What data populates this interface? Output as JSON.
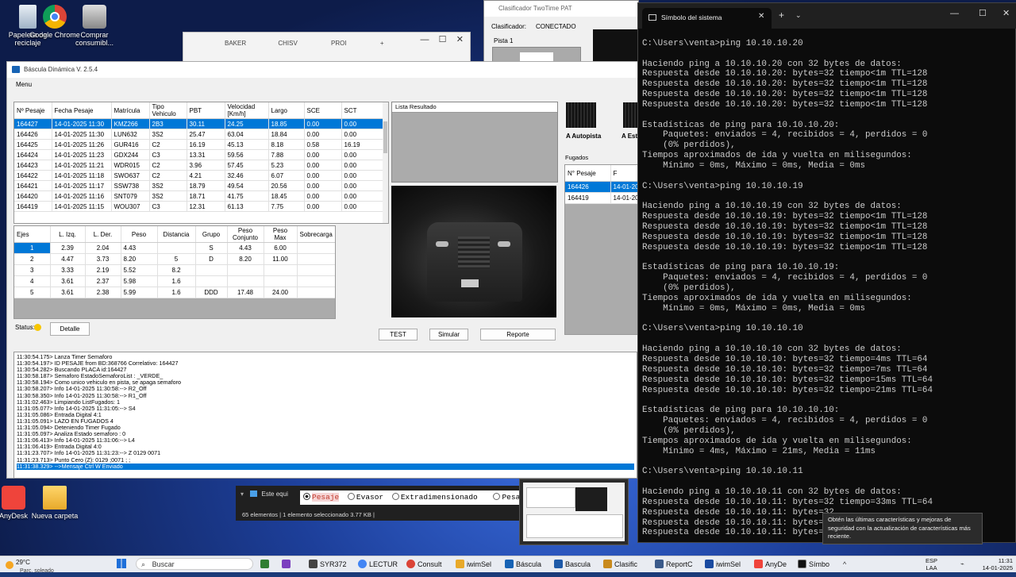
{
  "desktop": {
    "icons": [
      {
        "label": "Papelera de reciclaje"
      },
      {
        "label": "Google Chrome"
      },
      {
        "label": "Comprar consumibl..."
      },
      {
        "label": "AnyDesk"
      },
      {
        "label": "Nueva carpeta"
      }
    ]
  },
  "clasificador": {
    "title": "Clasificador TwoTime PAT",
    "status_label": "Clasificador:",
    "status_value": "CONECTADO",
    "pista": "Pista 1"
  },
  "explorer": {
    "tabs": [
      "BAKER",
      "CHISV",
      "PROI"
    ]
  },
  "app": {
    "title": "Báscula Dinámica V. 2.5.4",
    "menu": "Menu",
    "weighings": {
      "headers": [
        "Nº Pesaje",
        "Fecha Pesaje",
        "Matrícula",
        "Tipo Vehiculo",
        "PBT",
        "Velocidad [Km/h]",
        "Largo",
        "SCE",
        "SCT"
      ],
      "rows": [
        [
          "164427",
          "14-01-2025 11:30",
          "KMZ266",
          "2B3",
          "30.11",
          "24.25",
          "18.85",
          "0.00",
          "0.00"
        ],
        [
          "164426",
          "14-01-2025 11:30",
          "LUN632",
          "3S2",
          "25.47",
          "63.04",
          "18.84",
          "0.00",
          "0.00"
        ],
        [
          "164425",
          "14-01-2025 11:26",
          "GUR416",
          "C2",
          "16.19",
          "45.13",
          "8.18",
          "0.58",
          "16.19"
        ],
        [
          "164424",
          "14-01-2025 11:23",
          "GDX244",
          "C3",
          "13.31",
          "59.56",
          "7.88",
          "0.00",
          "0.00"
        ],
        [
          "164423",
          "14-01-2025 11:21",
          "WDR015",
          "C2",
          "3.96",
          "57.45",
          "5.23",
          "0.00",
          "0.00"
        ],
        [
          "164422",
          "14-01-2025 11:18",
          "SWO637",
          "C2",
          "4.21",
          "32.46",
          "6.07",
          "0.00",
          "0.00"
        ],
        [
          "164421",
          "14-01-2025 11:17",
          "SSW738",
          "3S2",
          "18.79",
          "49.54",
          "20.56",
          "0.00",
          "0.00"
        ],
        [
          "164420",
          "14-01-2025 11:16",
          "SNT079",
          "3S2",
          "18.71",
          "41.75",
          "18.45",
          "0.00",
          "0.00"
        ],
        [
          "164419",
          "14-01-2025 11:15",
          "WOU307",
          "C3",
          "12.31",
          "61.13",
          "7.75",
          "0.00",
          "0.00"
        ]
      ]
    },
    "axles": {
      "headers": [
        "Ejes",
        "L. Izq.",
        "L. Der.",
        "Peso",
        "Distancia",
        "Grupo",
        "Peso Conjunto",
        "Peso Max",
        "Sobrecarga"
      ],
      "rows": [
        [
          "1",
          "2.39",
          "2.04",
          "4.43",
          "",
          "S",
          "4.43",
          "6.00",
          ""
        ],
        [
          "2",
          "4.47",
          "3.73",
          "8.20",
          "5",
          "D",
          "8.20",
          "11.00",
          ""
        ],
        [
          "3",
          "3.33",
          "2.19",
          "5.52",
          "8.2",
          "",
          "",
          "",
          ""
        ],
        [
          "4",
          "3.61",
          "2.37",
          "5.98",
          "1.6",
          "",
          "",
          "",
          ""
        ],
        [
          "5",
          "3.61",
          "2.38",
          "5.99",
          "1.6",
          "DDD",
          "17.48",
          "24.00",
          ""
        ]
      ]
    },
    "result_list_label": "Lista Resultado",
    "status_label": "Status:",
    "detail_button": "Detalle",
    "test_button": "TEST",
    "simulate_button": "Simular",
    "report_button": "Reporte",
    "lane_labels": [
      "A Autopista",
      "A Est"
    ],
    "fugados": {
      "label": "Fugados",
      "headers": [
        "N° Pesaje",
        "F"
      ],
      "rows": [
        [
          "164426",
          "14-01-2025"
        ],
        [
          "164419",
          "14-01-2025"
        ]
      ]
    },
    "log": [
      "11:30:54.175> Lanza Timer Semaforo",
      "11:30:54.197> ID PESAJE from BD:368766 Correlativo: 164427",
      "11:30:54.282> Buscando PLACA id:164427",
      "11:30:58.187> Semaforo EstadoSemaforoList : _VERDE_",
      "11:30:58.194> Como unico vehiculo en pista, se apaga semaforo",
      "11:30:58.207> Info 14-01-2025 11:30:58:--> R2_Off",
      "11:30:58.350> Info 14-01-2025 11:30:58:--> R1_Off",
      "11:31:02.463> Limpiando ListFugados: 1",
      "11:31:05.077> Info 14-01-2025 11:31:05:--> S4",
      "11:31:05.086> Entrada Digital  4:1",
      "11:31:05.091> LAZO EN FUGADOS 4",
      "11:31:05.094> Deteniendo Timer Fugado",
      "11:31:05.097> Analiza Estado semaforo : 0",
      "11:31:06.413> Info 14-01-2025 11:31:06:--> L4",
      "11:31:06.419> Entrada Digital  4:0",
      "11:31:23.707> Info 14-01-2025 11:31:23:--> Z 0129 0071",
      "11:31:23.713> Punto Cero (Z): 0129 ;0071 ; ;",
      "11:31:38.329> -->Mensaje Ctrl W Enviado"
    ]
  },
  "explorer_bar": {
    "item": "Este equi",
    "status": "65 elementos  |  1 elemento seleccionado  3.77 KB  |"
  },
  "radios": {
    "options": [
      "Pesaje",
      "Evasor",
      "Extradimensionado",
      "Pesaj"
    ]
  },
  "terminal": {
    "tab_title": "Símbolo del sistema",
    "lines": [
      "",
      "C:\\Users\\venta>ping 10.10.10.20",
      "",
      "Haciendo ping a 10.10.10.20 con 32 bytes de datos:",
      "Respuesta desde 10.10.10.20: bytes=32 tiempo<1m TTL=128",
      "Respuesta desde 10.10.10.20: bytes=32 tiempo<1m TTL=128",
      "Respuesta desde 10.10.10.20: bytes=32 tiempo<1m TTL=128",
      "Respuesta desde 10.10.10.20: bytes=32 tiempo<1m TTL=128",
      "",
      "Estadísticas de ping para 10.10.10.20:",
      "    Paquetes: enviados = 4, recibidos = 4, perdidos = 0",
      "    (0% perdidos),",
      "Tiempos aproximados de ida y vuelta en milisegundos:",
      "    Mínimo = 0ms, Máximo = 0ms, Media = 0ms",
      "",
      "C:\\Users\\venta>ping 10.10.10.19",
      "",
      "Haciendo ping a 10.10.10.19 con 32 bytes de datos:",
      "Respuesta desde 10.10.10.19: bytes=32 tiempo<1m TTL=128",
      "Respuesta desde 10.10.10.19: bytes=32 tiempo<1m TTL=128",
      "Respuesta desde 10.10.10.19: bytes=32 tiempo<1m TTL=128",
      "Respuesta desde 10.10.10.19: bytes=32 tiempo<1m TTL=128",
      "",
      "Estadísticas de ping para 10.10.10.19:",
      "    Paquetes: enviados = 4, recibidos = 4, perdidos = 0",
      "    (0% perdidos),",
      "Tiempos aproximados de ida y vuelta en milisegundos:",
      "    Mínimo = 0ms, Máximo = 0ms, Media = 0ms",
      "",
      "C:\\Users\\venta>ping 10.10.10.10",
      "",
      "Haciendo ping a 10.10.10.10 con 32 bytes de datos:",
      "Respuesta desde 10.10.10.10: bytes=32 tiempo=4ms TTL=64",
      "Respuesta desde 10.10.10.10: bytes=32 tiempo=7ms TTL=64",
      "Respuesta desde 10.10.10.10: bytes=32 tiempo=15ms TTL=64",
      "Respuesta desde 10.10.10.10: bytes=32 tiempo=21ms TTL=64",
      "",
      "Estadísticas de ping para 10.10.10.10:",
      "    Paquetes: enviados = 4, recibidos = 4, perdidos = 0",
      "    (0% perdidos),",
      "Tiempos aproximados de ida y vuelta en milisegundos:",
      "    Mínimo = 4ms, Máximo = 21ms, Media = 11ms",
      "",
      "C:\\Users\\venta>ping 10.10.10.11",
      "",
      "Haciendo ping a 10.10.10.11 con 32 bytes de datos:",
      "Respuesta desde 10.10.10.11: bytes=32 tiempo=33ms TTL=64",
      "Respuesta desde 10.10.10.11: bytes=32",
      "Respuesta desde 10.10.10.11: bytes=32",
      "Respuesta desde 10.10.10.11: bytes=32"
    ]
  },
  "tooltip": "Obtén las últimas características y mejoras de seguridad con la actualización de características más reciente.",
  "taskbar": {
    "weather_temp": "29°C",
    "weather_desc": "Parc. soleado",
    "search": "Buscar",
    "apps": [
      "SYR372",
      "LECTUR",
      "Consult",
      "iwimSel",
      "Báscula",
      "Bascula",
      "Clasific",
      "ReportC",
      "iwimSel",
      "AnyDe",
      "Símbo"
    ],
    "lang": "ESP",
    "lang2": "LAA",
    "time": "11:31",
    "date": "14-01-2025"
  }
}
